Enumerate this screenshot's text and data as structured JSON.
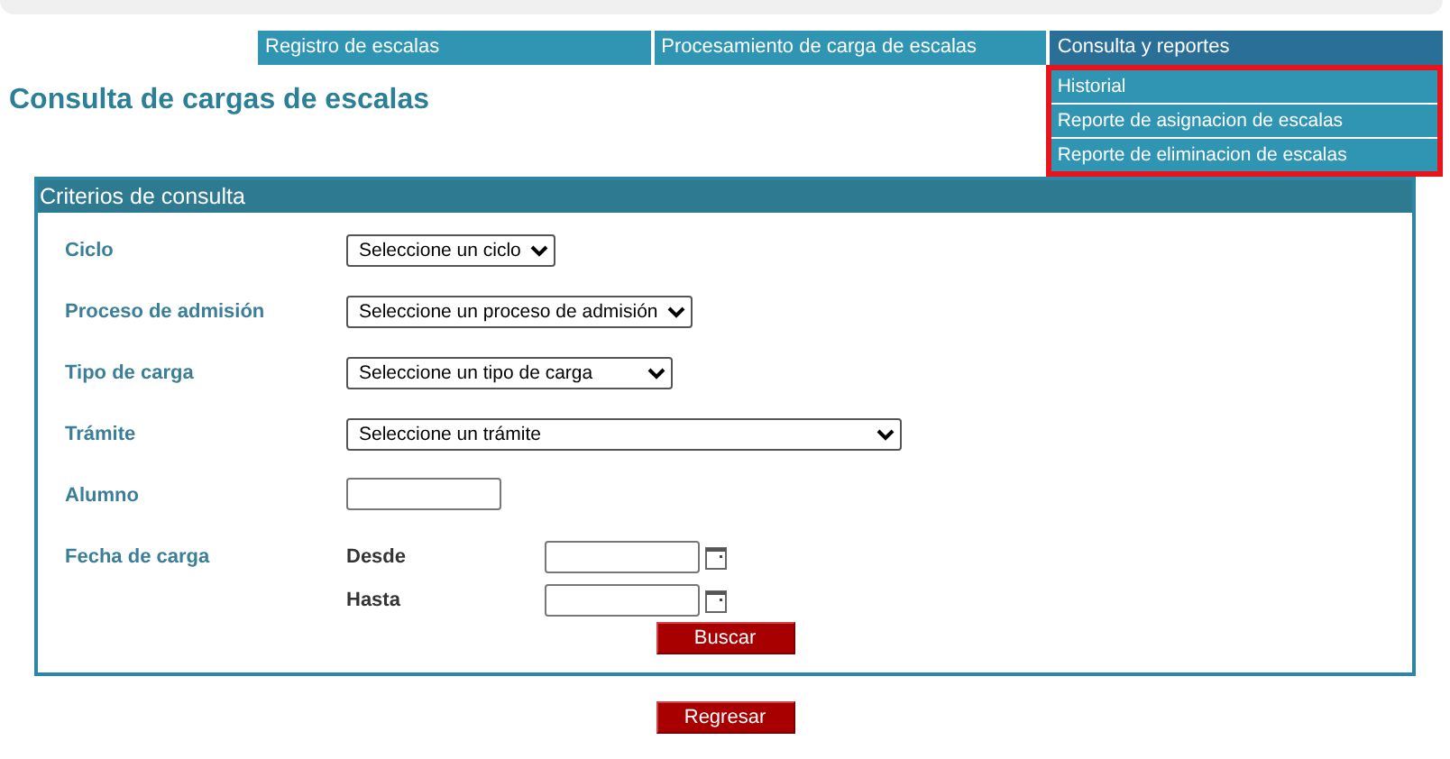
{
  "nav": {
    "tabs": [
      {
        "label": "Registro de escalas",
        "selected": false
      },
      {
        "label": "Procesamiento de carga de escalas",
        "selected": false
      },
      {
        "label": "Consulta y reportes",
        "selected": true
      }
    ],
    "menu": {
      "highlighted": true,
      "items": [
        {
          "label": "Historial"
        },
        {
          "label": "Reporte de asignacion de escalas"
        },
        {
          "label": "Reporte de eliminacion de escalas"
        }
      ]
    }
  },
  "page_title": "Consulta de cargas de escalas",
  "panel": {
    "title": "Criterios de consulta",
    "fields": [
      {
        "kind": "select",
        "label": "Ciclo",
        "value": "Seleccione un ciclo"
      },
      {
        "kind": "select",
        "label": "Proceso de admisión",
        "value": "Seleccione un proceso de admisión"
      },
      {
        "kind": "select",
        "label": "Tipo de carga",
        "value": "Seleccione un tipo de carga"
      },
      {
        "kind": "select",
        "label": "Trámite",
        "value": "Seleccione un trámite"
      },
      {
        "kind": "text",
        "label": "Alumno"
      },
      {
        "kind": "daterange",
        "label": "Fecha de carga",
        "from_label": "Desde",
        "to_label": "Hasta"
      }
    ],
    "search_button": "Buscar"
  },
  "back_button": "Regresar"
}
